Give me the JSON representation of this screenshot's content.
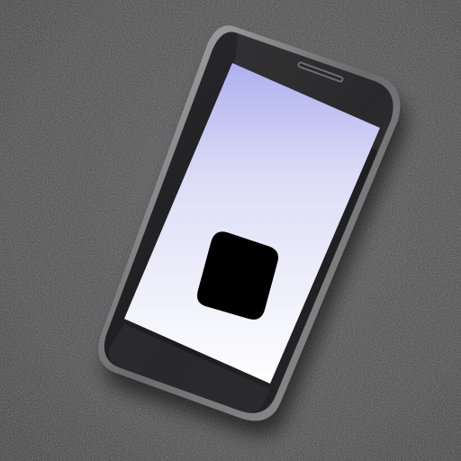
{
  "scene": {
    "description_free": true,
    "surface_color": "#3a3a3c",
    "phone_body_color": "#1e1e20",
    "phone_frame_color": "#8a8a8c",
    "screen_gradient_top": "#aeb0f0",
    "screen_gradient_bottom": "#ffffff",
    "app_icon_color": "#000000",
    "icons": [
      "earpiece-speaker",
      "app-icon"
    ]
  }
}
